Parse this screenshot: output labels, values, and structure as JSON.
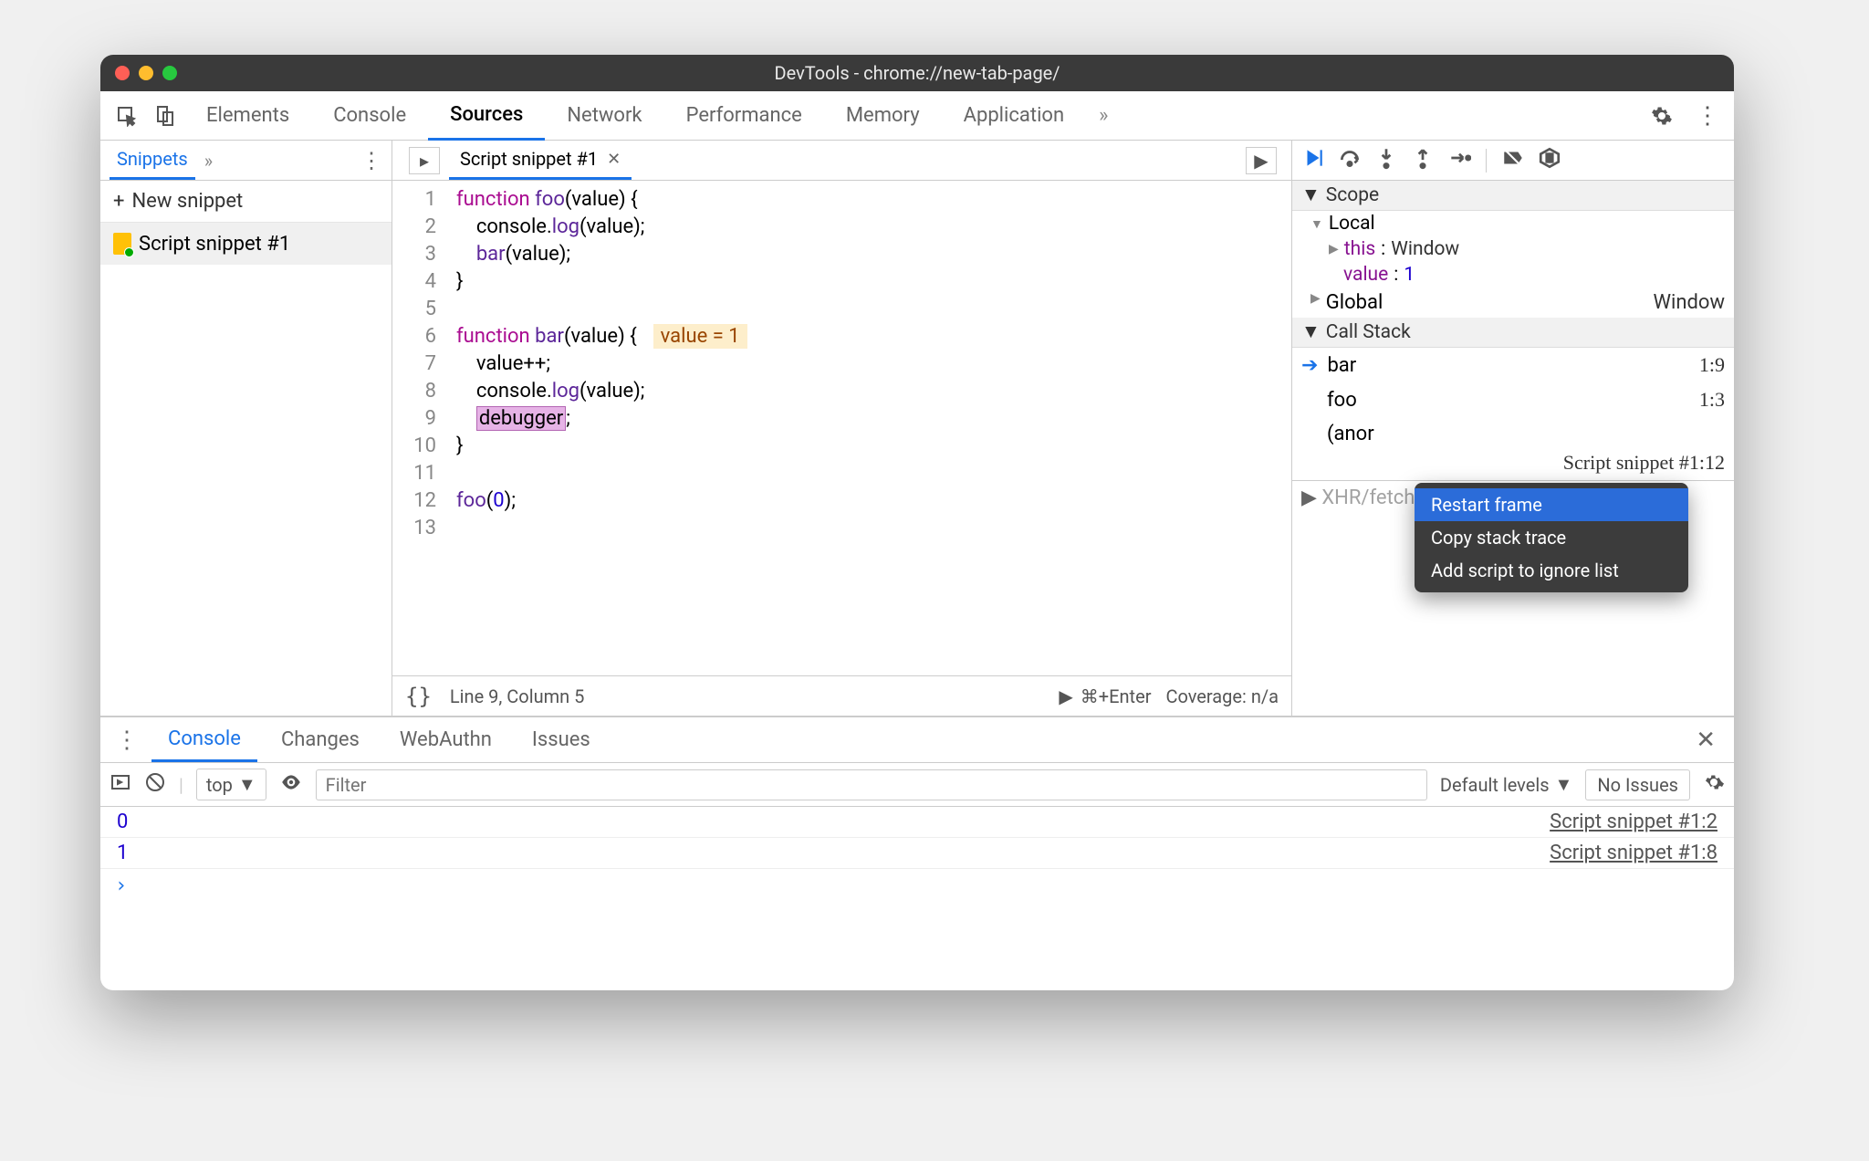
{
  "window": {
    "title": "DevTools - chrome://new-tab-page/"
  },
  "mainTabs": [
    "Elements",
    "Console",
    "Sources",
    "Network",
    "Performance",
    "Memory",
    "Application"
  ],
  "activeMainTab": "Sources",
  "leftPanel": {
    "tab": "Snippets",
    "newSnippet": "New snippet",
    "items": [
      "Script snippet #1"
    ]
  },
  "editor": {
    "tabLabel": "Script snippet #1",
    "lines": [
      "function foo(value) {",
      "    console.log(value);",
      "    bar(value);",
      "}",
      "",
      "function bar(value) {",
      "    value++;",
      "    console.log(value);",
      "    debugger;",
      "}",
      "",
      "foo(0);",
      ""
    ],
    "inlineHint": "value = 1",
    "statusCursor": "Line 9, Column 5",
    "statusRun": "⌘+Enter",
    "statusCoverage": "Coverage: n/a"
  },
  "debugger": {
    "scopeHeader": "Scope",
    "local": "Local",
    "thisLabel": "this",
    "thisValue": "Window",
    "valueLabel": "value",
    "valueValue": "1",
    "globalLabel": "Global",
    "globalValue": "Window",
    "callStackHeader": "Call Stack",
    "frames": [
      {
        "name": "bar",
        "loc": "1:9"
      },
      {
        "name": "foo",
        "loc": "1:3"
      },
      {
        "name": "(anor",
        "loc": ""
      }
    ],
    "anonFrameTail": "Script snippet #1:12",
    "xhrHeader": "XHR/fetch Breakpoints",
    "contextMenu": [
      "Restart frame",
      "Copy stack trace",
      "Add script to ignore list"
    ]
  },
  "drawer": {
    "tabs": [
      "Console",
      "Changes",
      "WebAuthn",
      "Issues"
    ],
    "activeTab": "Console",
    "contextLabel": "top",
    "filterPlaceholder": "Filter",
    "levels": "Default levels",
    "noIssues": "No Issues",
    "logs": [
      {
        "val": "0",
        "src": "Script snippet #1:2"
      },
      {
        "val": "1",
        "src": "Script snippet #1:8"
      }
    ]
  }
}
